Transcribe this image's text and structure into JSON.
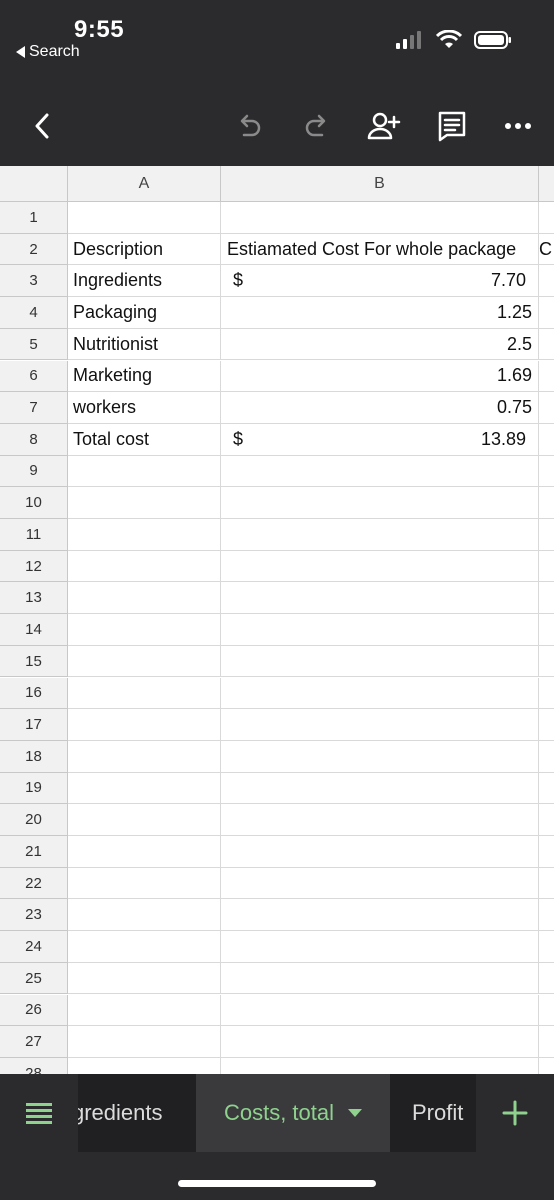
{
  "status_bar": {
    "time": "9:55",
    "back_label": "Search",
    "icons": [
      "cellular-signal-icon",
      "wifi-icon",
      "battery-icon"
    ]
  },
  "toolbar": {
    "icons": [
      "back-chevron-icon",
      "undo-icon",
      "redo-icon",
      "share-add-person-icon",
      "comment-icon",
      "more-icon"
    ]
  },
  "sheet": {
    "columns": [
      "A",
      "B"
    ],
    "rows": [
      {
        "num": "1",
        "a": "",
        "b_prefix": "",
        "b_value": "",
        "c": ""
      },
      {
        "num": "2",
        "a": "Description",
        "b_prefix": "",
        "b_value": "Estiamated Cost For whole package",
        "c": "C"
      },
      {
        "num": "3",
        "a": "Ingredients",
        "b_prefix": "$",
        "b_value": "7.70",
        "c": ""
      },
      {
        "num": "4",
        "a": "Packaging",
        "b_prefix": "",
        "b_value": "1.25",
        "c": ""
      },
      {
        "num": "5",
        "a": "Nutritionist",
        "b_prefix": "",
        "b_value": "2.5",
        "c": ""
      },
      {
        "num": "6",
        "a": "Marketing",
        "b_prefix": "",
        "b_value": "1.69",
        "c": ""
      },
      {
        "num": "7",
        "a": "workers",
        "b_prefix": "",
        "b_value": "0.75",
        "c": ""
      },
      {
        "num": "8",
        "a": "Total cost",
        "b_prefix": "$",
        "b_value": "13.89",
        "c": ""
      },
      {
        "num": "9"
      },
      {
        "num": "10"
      },
      {
        "num": "11"
      },
      {
        "num": "12"
      },
      {
        "num": "13"
      },
      {
        "num": "14"
      },
      {
        "num": "15"
      },
      {
        "num": "16"
      },
      {
        "num": "17"
      },
      {
        "num": "18"
      },
      {
        "num": "19"
      },
      {
        "num": "20"
      },
      {
        "num": "21"
      },
      {
        "num": "22"
      },
      {
        "num": "23"
      },
      {
        "num": "24"
      },
      {
        "num": "25"
      },
      {
        "num": "26"
      },
      {
        "num": "27"
      },
      {
        "num": "28"
      }
    ]
  },
  "tabs": {
    "ingredients": "gredients",
    "costs_total": "Costs, total",
    "profit": "Profit",
    "active_color": "#8ed28e"
  }
}
